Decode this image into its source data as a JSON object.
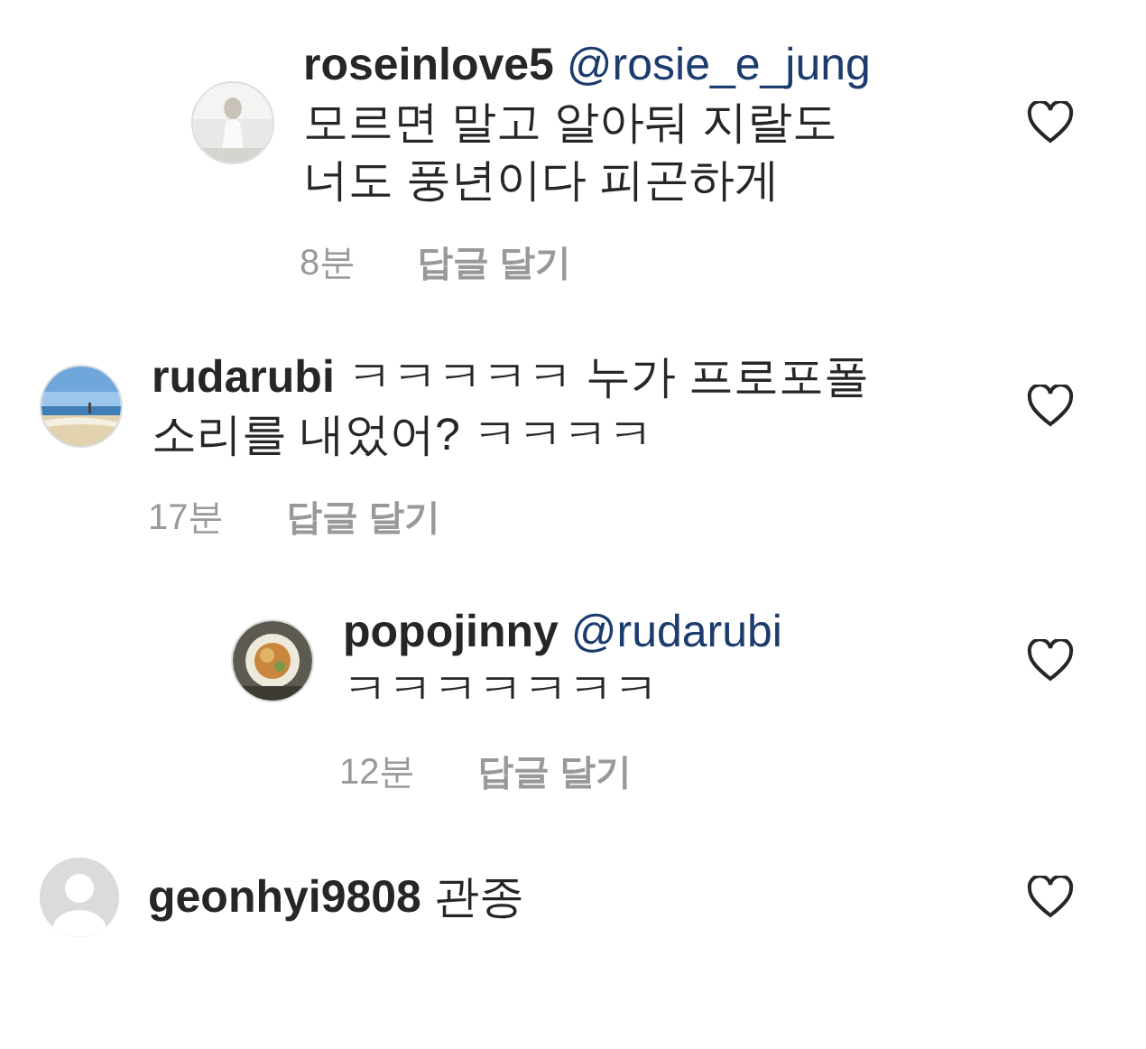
{
  "orphan_replies": [
    {
      "username": "roseinlove5",
      "mention": "@rosie_e_jung",
      "text": "모르면 말고 알아둬 지랄도 너도 풍년이다 피곤하게",
      "time": "8분",
      "reply_label": "답글 달기",
      "avatar": {
        "kind": "picture"
      },
      "liked": false
    }
  ],
  "comments": [
    {
      "username": "rudarubi",
      "text": "ㅋㅋㅋㅋㅋ 누가 프로포폴 소리를 내었어? ㅋㅋㅋㅋ",
      "time": "17분",
      "reply_label": "답글 달기",
      "avatar": {
        "kind": "picture"
      },
      "liked": false,
      "replies": [
        {
          "username": "popojinny",
          "mention": "@rudarubi",
          "text": "ㅋㅋㅋㅋㅋㅋㅋ",
          "time": "12분",
          "reply_label": "답글 달기",
          "avatar": {
            "kind": "picture"
          },
          "liked": false
        }
      ]
    },
    {
      "username": "geonhyi9808",
      "text": "관종",
      "avatar": {
        "kind": "default"
      },
      "liked": false
    }
  ]
}
